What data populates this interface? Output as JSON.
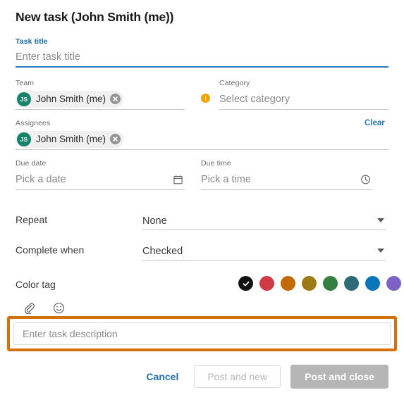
{
  "dialog": {
    "title": "New task (John Smith (me))"
  },
  "task_title": {
    "label": "Task title",
    "placeholder": "Enter task title",
    "value": "",
    "accent_color": "#176aab",
    "underline_color": "#2d7dbd"
  },
  "team": {
    "label": "Team",
    "chip": {
      "initials": "JS",
      "name": "John Smith (me)",
      "avatar_color": "#18836b",
      "remove_icon": "close-icon"
    }
  },
  "category": {
    "label": "Category",
    "placeholder": "Select category",
    "value": "",
    "warning_icon": "warning-icon",
    "warning_color": "#f2a20c"
  },
  "assignees": {
    "label": "Assignees",
    "clear_label": "Clear",
    "clear_color": "#2a7ab8",
    "chip": {
      "initials": "JS",
      "name": "John Smith (me)",
      "avatar_color": "#18836b",
      "remove_icon": "close-icon"
    }
  },
  "due_date": {
    "label": "Due date",
    "placeholder": "Pick a date",
    "value": "",
    "icon": "calendar-icon"
  },
  "due_time": {
    "label": "Due time",
    "placeholder": "Pick a time",
    "value": "",
    "icon": "clock-icon"
  },
  "repeat": {
    "label": "Repeat",
    "value": "None",
    "options": [
      "None"
    ],
    "icon": "chevron-down-icon"
  },
  "complete_when": {
    "label": "Complete when",
    "value": "Checked",
    "options": [
      "Checked"
    ],
    "icon": "chevron-down-icon"
  },
  "color_tag": {
    "label": "Color tag",
    "selected_index": 0,
    "selected_icon": "check-icon",
    "swatches": [
      {
        "name": "black",
        "hex": "#121212"
      },
      {
        "name": "red",
        "hex": "#ce3b43"
      },
      {
        "name": "orange",
        "hex": "#c36a06"
      },
      {
        "name": "gold",
        "hex": "#9c7a18"
      },
      {
        "name": "green",
        "hex": "#35803f"
      },
      {
        "name": "teal",
        "hex": "#2f6a77"
      },
      {
        "name": "blue",
        "hex": "#0c74b8"
      },
      {
        "name": "purple",
        "hex": "#7b62c4"
      }
    ]
  },
  "editor_toolbar": {
    "attach_icon": "paperclip-icon",
    "emoji_icon": "smiley-icon"
  },
  "description": {
    "placeholder": "Enter task description",
    "value": "",
    "highlight_color": "#d4700e"
  },
  "footer": {
    "cancel_label": "Cancel",
    "post_and_new_label": "Post and new",
    "post_and_close_label": "Post and close"
  }
}
